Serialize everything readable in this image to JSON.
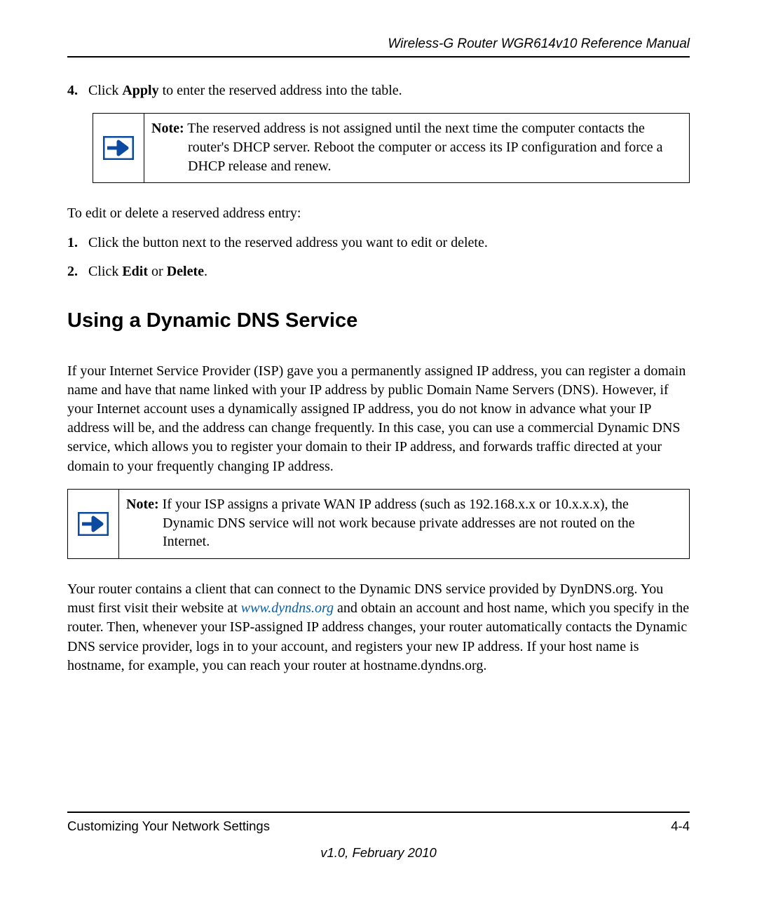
{
  "header": {
    "title": "Wireless-G Router WGR614v10 Reference Manual"
  },
  "step4": {
    "num": "4.",
    "pre": "Click ",
    "bold": "Apply",
    "post": " to enter the reserved address into the table."
  },
  "note1": {
    "label": "Note:",
    "text": " The reserved address is not assigned until the next time the computer contacts the router's DHCP server. Reboot the computer or access its IP configuration and force a DHCP release and renew."
  },
  "edit_intro": "To edit or delete a reserved address entry:",
  "estep1": {
    "num": "1.",
    "text": "Click the button next to the reserved address you want to edit or delete."
  },
  "estep2": {
    "num": "2.",
    "pre": "Click ",
    "b1": "Edit",
    "mid": " or ",
    "b2": "Delete",
    "post": "."
  },
  "heading": "Using a Dynamic DNS Service",
  "para1": "If your Internet Service Provider (ISP) gave you a permanently assigned IP address, you can register a domain name and have that name linked with your IP address by public Domain Name Servers (DNS). However, if your Internet account uses a dynamically assigned IP address, you do not know in advance what your IP address will be, and the address can change frequently. In this case, you can use a commercial Dynamic DNS service, which allows you to register your domain to their IP address, and forwards traffic directed at your domain to your frequently changing IP address.",
  "note2": {
    "label": "Note:",
    "text": " If your ISP assigns a private WAN IP address (such as 192.168.x.x or 10.x.x.x), the Dynamic DNS service will not work because private addresses are not routed on the Internet."
  },
  "para2_pre": "Your router contains a client that can connect to the Dynamic DNS service provided by DynDNS.org. You must first visit their website at ",
  "para2_link": "www.dyndns.org",
  "para2_post": " and obtain an account and host name, which you specify in the router. Then, whenever your ISP-assigned IP address changes, your router automatically contacts the Dynamic DNS service provider, logs in to your account, and registers your new IP address. If your host name is hostname, for example, you can reach your router at hostname.dyndns.org.",
  "footer": {
    "section": "Customizing Your Network Settings",
    "page": "4-4",
    "version": "v1.0, February 2010"
  }
}
